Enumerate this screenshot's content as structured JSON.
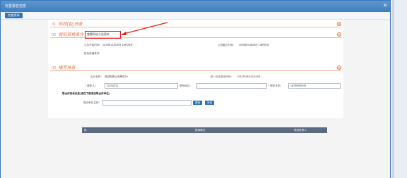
{
  "window": {
    "title": "完善报名信息",
    "close_glyph": "✕"
  },
  "toolbar": {
    "confirm_label": "完善资料"
  },
  "sections": [
    {
      "num": "01",
      "title": "标段(包)信息",
      "toggle": "⊖"
    },
    {
      "num": "02",
      "title": "投标资格条件：",
      "toggle": "⊖"
    },
    {
      "num": "03",
      "title": "填写信息",
      "toggle": "⊖"
    }
  ],
  "highlight_text": "查看网站公告原文",
  "notice": {
    "start_label": "公告开始时间：",
    "start_value": "2019年11月29日 14时25分",
    "end_label": "公告截止时间：",
    "end_value": "2020年01月05日 14时30分",
    "qual_label": "投标资格条件："
  },
  "form": {
    "company_label": "企业名称：",
    "company_value": "测试用的公司单位10",
    "credit_label": "统一社会信用代码：",
    "credit_value": "111123451111111111",
    "contact_label": "联系人：",
    "contact_value": "22134213",
    "address_label": "联系地址：",
    "address_value": "",
    "phone_label": "联系手机：",
    "phone_value": "16789005245",
    "union_title": "联合体投标信息(请在下面添加联合体单位)",
    "union_label": "联合单位名称：",
    "union_value": "",
    "search_label": "搜索",
    "add_label": "添加",
    "table_cols": [
      "序",
      "投标单位",
      "项目负责人"
    ]
  }
}
